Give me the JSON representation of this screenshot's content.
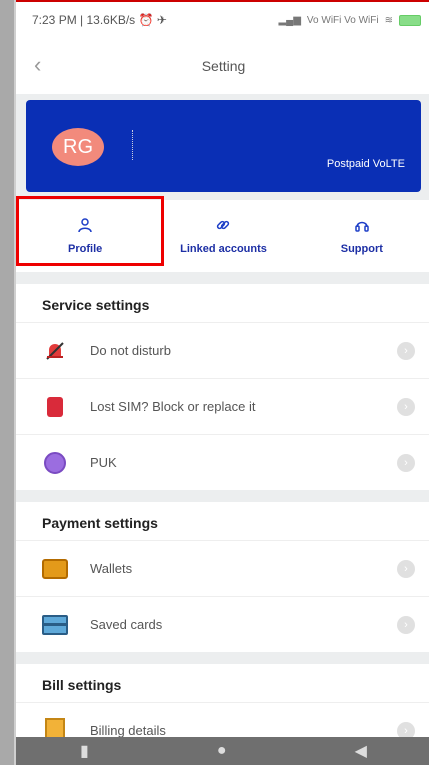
{
  "status": {
    "left": "7:23 PM | 13.6KB/s ⏰ ✈",
    "right": "Vo WiFi Vo WiFi",
    "battery": "75"
  },
  "header": {
    "title": "Setting"
  },
  "profile": {
    "initials": "RG",
    "plan": "Postpaid VoLTE"
  },
  "quick_actions": [
    {
      "label": "Profile",
      "icon": "person-icon"
    },
    {
      "label": "Linked accounts",
      "icon": "link-icon"
    },
    {
      "label": "Support",
      "icon": "headset-icon"
    }
  ],
  "service": {
    "title": "Service settings",
    "items": [
      {
        "label": "Do not disturb",
        "icon": "bell-off-icon"
      },
      {
        "label": "Lost SIM? Block or replace it",
        "icon": "sim-icon"
      },
      {
        "label": "PUK",
        "icon": "puk-icon"
      }
    ]
  },
  "payment": {
    "title": "Payment settings",
    "items": [
      {
        "label": "Wallets",
        "icon": "wallet-icon"
      },
      {
        "label": "Saved cards",
        "icon": "card-icon"
      }
    ]
  },
  "bill": {
    "title": "Bill settings",
    "items": [
      {
        "label": "Billing details",
        "icon": "bill-icon"
      }
    ]
  },
  "accent": "#0a2fb5"
}
